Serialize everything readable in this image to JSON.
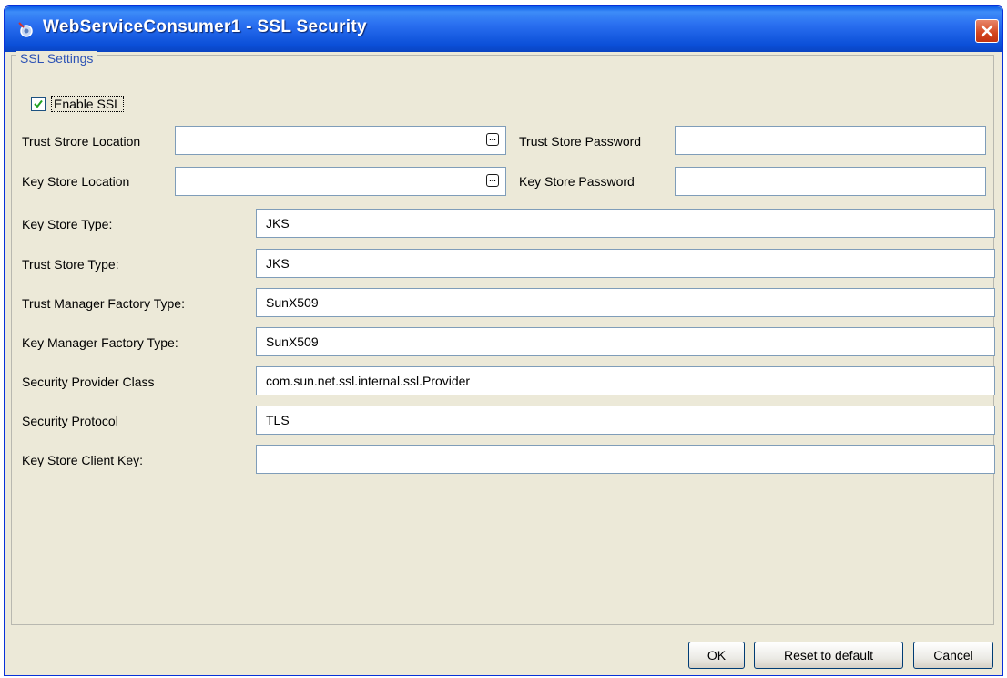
{
  "window": {
    "title": "WebServiceConsumer1 - SSL Security"
  },
  "group": {
    "label": "SSL Settings"
  },
  "enable_ssl": {
    "label": "Enable SSL",
    "checked": true
  },
  "trust_store_location": {
    "label": "Trust Strore Location",
    "value": ""
  },
  "trust_store_password": {
    "label": "Trust Store Password",
    "value": ""
  },
  "key_store_location": {
    "label": "Key Store Location",
    "value": ""
  },
  "key_store_password": {
    "label": "Key Store Password",
    "value": ""
  },
  "key_store_type": {
    "label": "Key Store Type:",
    "value": "JKS"
  },
  "trust_store_type": {
    "label": "Trust Store Type:",
    "value": "JKS"
  },
  "trust_manager_factory_type": {
    "label": "Trust Manager Factory Type:",
    "value": "SunX509"
  },
  "key_manager_factory_type": {
    "label": "Key Manager Factory Type:",
    "value": "SunX509"
  },
  "security_provider_class": {
    "label": "Security Provider Class",
    "value": "com.sun.net.ssl.internal.ssl.Provider"
  },
  "security_protocol": {
    "label": "Security Protocol",
    "value": "TLS"
  },
  "key_store_client_key": {
    "label": "Key Store Client Key:",
    "value": ""
  },
  "buttons": {
    "ok": "OK",
    "reset": "Reset to default",
    "cancel": "Cancel"
  },
  "browse_glyph": "...",
  "colors": {
    "titlebar": "#0b4fd8",
    "dialog_bg": "#ece9d8",
    "group_label": "#2c52b5",
    "close": "#d4461e"
  }
}
